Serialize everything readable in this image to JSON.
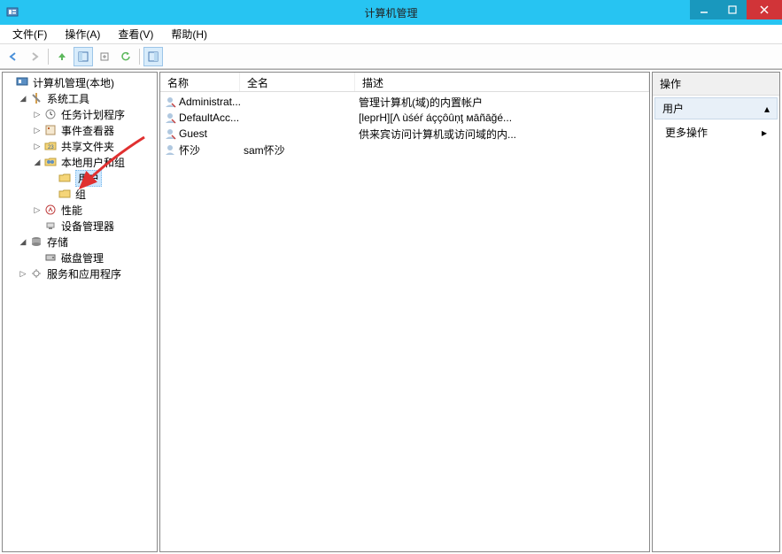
{
  "window": {
    "title": "计算机管理"
  },
  "menu": {
    "file": "文件(F)",
    "action": "操作(A)",
    "view": "查看(V)",
    "help": "帮助(H)"
  },
  "tree": {
    "root": "计算机管理(本地)",
    "system_tools": "系统工具",
    "task_scheduler": "任务计划程序",
    "event_viewer": "事件查看器",
    "shared_folders": "共享文件夹",
    "local_users": "本地用户和组",
    "users": "用户",
    "groups": "组",
    "performance": "性能",
    "device_manager": "设备管理器",
    "storage": "存储",
    "disk_management": "磁盘管理",
    "services_apps": "服务和应用程序"
  },
  "list": {
    "columns": {
      "name": "名称",
      "fullname": "全名",
      "description": "描述"
    },
    "rows": [
      {
        "name": "Administrat...",
        "fullname": "",
        "desc": "管理计算机(域)的内置帐户"
      },
      {
        "name": "DefaultAcc...",
        "fullname": "",
        "desc": "[leprH][Λ ùśéŕ áççôûņţ мāñāğé..."
      },
      {
        "name": "Guest",
        "fullname": "",
        "desc": "供来宾访问计算机或访问域的内..."
      },
      {
        "name": "怀沙",
        "fullname": "sam怀沙",
        "desc": ""
      }
    ]
  },
  "actions": {
    "header": "操作",
    "section": "用户",
    "more": "更多操作"
  }
}
